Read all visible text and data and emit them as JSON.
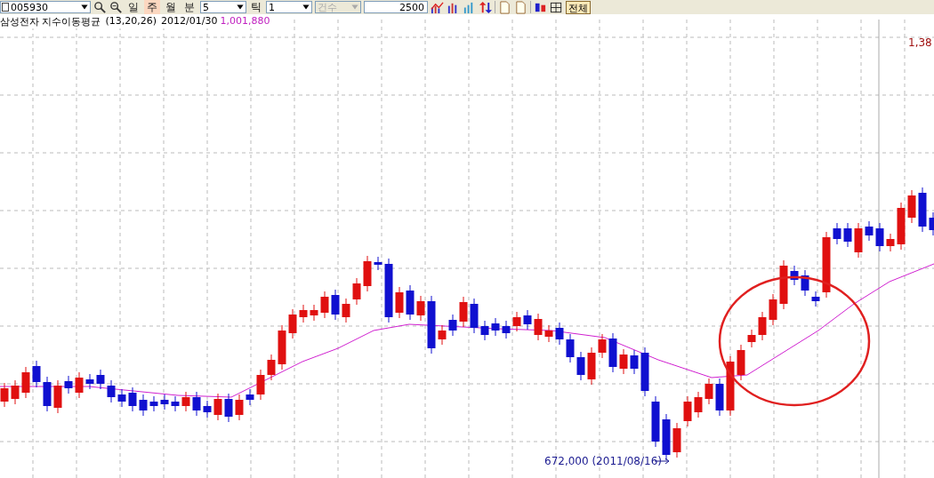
{
  "toolbar": {
    "code_field": "005930",
    "periods": [
      {
        "label": "일",
        "selected": false
      },
      {
        "label": "주",
        "selected": true
      },
      {
        "label": "월",
        "selected": false
      },
      {
        "label": "분",
        "selected": false
      }
    ],
    "minute_field": "5",
    "tick_label": "틱",
    "tick_field": "1",
    "count_dropdown": {
      "label": "건수",
      "disabled": true
    },
    "count_field": "2500",
    "all_button": "전체"
  },
  "legend": {
    "title": "삼성전자 지수이동평균",
    "params": "(13,20,26)",
    "date": "2012/01/30",
    "value": "1,001,880"
  },
  "price_label": "1,38",
  "low_annotation": "672,000 (2011/08/16)"
}
